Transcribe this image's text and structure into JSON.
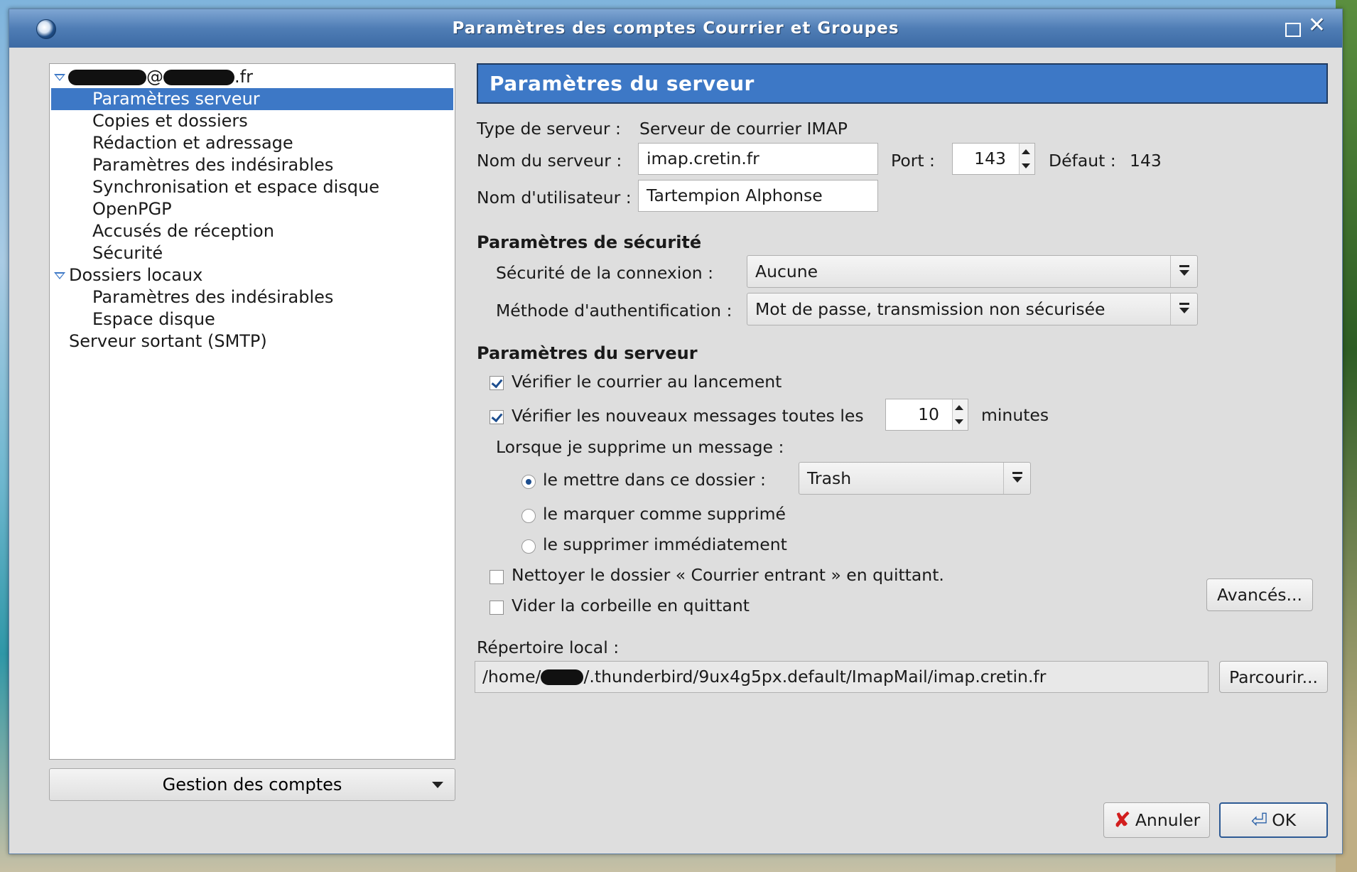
{
  "window": {
    "title": "Paramètres des comptes Courrier et Groupes"
  },
  "tree": {
    "account_suffix": ".fr",
    "account_at": "@",
    "items": [
      {
        "label": "Paramètres serveur"
      },
      {
        "label": "Copies et dossiers"
      },
      {
        "label": "Rédaction et adressage"
      },
      {
        "label": "Paramètres des indésirables"
      },
      {
        "label": "Synchronisation et espace disque"
      },
      {
        "label": "OpenPGP"
      },
      {
        "label": "Accusés de réception"
      },
      {
        "label": "Sécurité"
      }
    ],
    "local": {
      "label": "Dossiers locaux",
      "items": [
        {
          "label": "Paramètres des indésirables"
        },
        {
          "label": "Espace disque"
        }
      ]
    },
    "smtp_label": "Serveur sortant (SMTP)"
  },
  "gestion_label": "Gestion des comptes",
  "panel": {
    "header": "Paramètres du serveur",
    "server_type_label": "Type de serveur :",
    "server_type_value": "Serveur de courrier IMAP",
    "server_name_label": "Nom du serveur :",
    "server_name_value": "imap.cretin.fr",
    "port_label": "Port :",
    "port_value": "143",
    "default_label": "Défaut :",
    "default_value": "143",
    "username_label": "Nom d'utilisateur :",
    "username_value": "Tartempion Alphonse",
    "security_heading": "Paramètres de sécurité",
    "conn_security_label": "Sécurité de la connexion :",
    "conn_security_value": "Aucune",
    "auth_method_label": "Méthode d'authentification :",
    "auth_method_value": "Mot de passe, transmission non sécurisée",
    "server_heading": "Paramètres du serveur",
    "check_startup_label": "Vérifier le courrier au lancement",
    "check_every_label": "Vérifier les nouveaux messages toutes les",
    "check_every_value": "10",
    "minutes_label": "minutes",
    "on_delete_label": "Lorsque je supprime un message :",
    "move_to_folder_label": "le mettre dans ce dossier :",
    "folder_value": "Trash",
    "mark_deleted_label": "le marquer comme supprimé",
    "delete_now_label": "le supprimer immédiatement",
    "clean_inbox_label": "Nettoyer le dossier « Courrier entrant » en quittant.",
    "empty_trash_label": "Vider la corbeille en quittant",
    "advanced_label": "Avancés...",
    "local_dir_label": "Répertoire local :",
    "local_dir_prefix": "/home/",
    "local_dir_suffix": "/.thunderbird/9ux4g5px.default/ImapMail/imap.cretin.fr",
    "browse_label": "Parcourir..."
  },
  "footer": {
    "cancel_label": "Annuler",
    "ok_label": "OK"
  }
}
